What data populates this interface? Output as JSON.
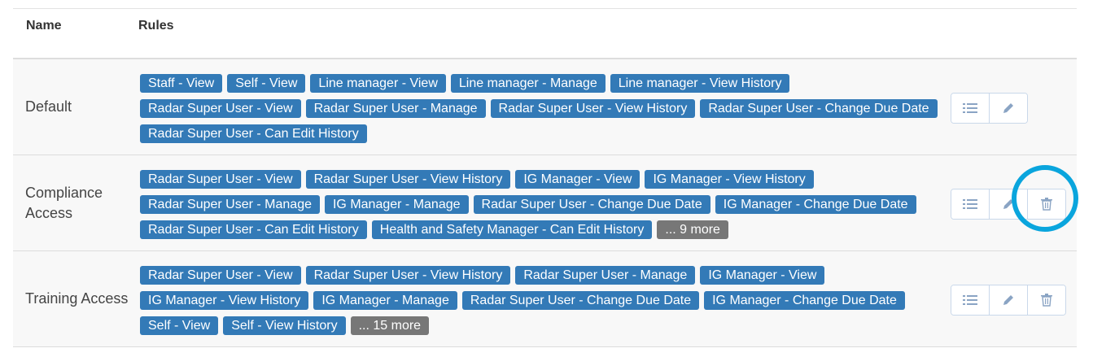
{
  "table": {
    "headers": {
      "name": "Name",
      "rules": "Rules"
    },
    "rows": [
      {
        "name": "Default",
        "rules": [
          "Staff - View",
          "Self - View",
          "Line manager - View",
          "Line manager - Manage",
          "Line manager - View History",
          "Radar Super User - View",
          "Radar Super User - Manage",
          "Radar Super User - View History",
          "Radar Super User - Change Due Date",
          "Radar Super User - Can Edit History"
        ],
        "more": ""
      },
      {
        "name": "Compliance Access",
        "rules": [
          "Radar Super User - View",
          "Radar Super User - View History",
          "IG Manager - View",
          "IG Manager - View History",
          "Radar Super User - Manage",
          "IG Manager - Manage",
          "Radar Super User - Change Due Date",
          "IG Manager - Change Due Date",
          "Radar Super User - Can Edit History",
          "Health and Safety Manager - Can Edit History"
        ],
        "more": "... 9 more"
      },
      {
        "name": "Training Access",
        "rules": [
          "Radar Super User - View",
          "Radar Super User - View History",
          "Radar Super User - Manage",
          "IG Manager - View",
          "IG Manager - View History",
          "IG Manager - Manage",
          "Radar Super User - Change Due Date",
          "IG Manager - Change Due Date",
          "Self - View",
          "Self - View History"
        ],
        "more": "... 15 more"
      }
    ]
  },
  "icons": {
    "list": "list-icon",
    "edit": "pencil-icon",
    "delete": "trash-icon"
  },
  "colors": {
    "tag": "#337ab7",
    "more_tag": "#777777",
    "row_bg": "#f8f8f8",
    "highlight": "#0aa5dd",
    "icon": "#8aa4c4"
  }
}
